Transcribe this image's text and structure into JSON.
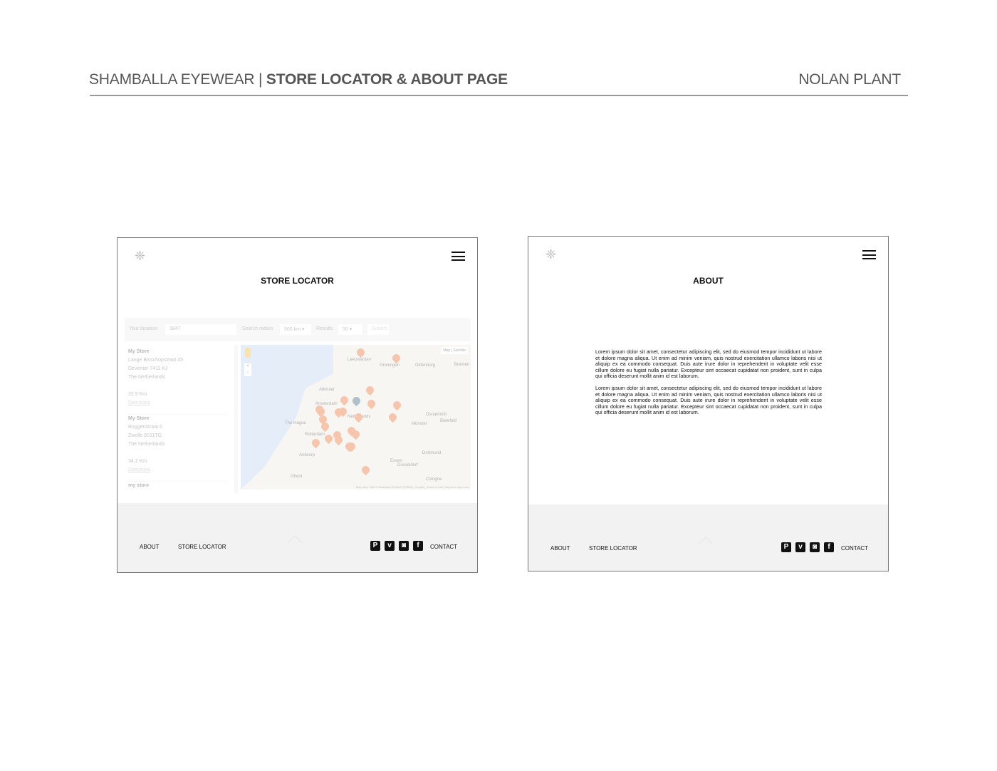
{
  "header": {
    "brand": "SHAMBALLA EYEWEAR",
    "separator": "|",
    "title": "STORE LOCATOR & ABOUT PAGE",
    "author": "NOLAN PLANT"
  },
  "store_page": {
    "title": "STORE LOCATOR",
    "search": {
      "location_label": "Your location",
      "location_value": "3847",
      "radius_label": "Search radius",
      "radius_value": "500 km",
      "results_label": "Results",
      "results_value": "50",
      "search_button": "Search"
    },
    "stores": [
      {
        "name": "My Store",
        "street": "Lange Bisschopstraat 45",
        "city": "Deventer 7411 KJ",
        "country": "The Netherlands",
        "distance": "33.9 Km",
        "directions": "Directions"
      },
      {
        "name": "My Store",
        "street": "Roggenstraat 6",
        "city": "Zwolle 8011TG",
        "country": "The Netherlands",
        "distance": "34.2 Km",
        "directions": "Directions"
      },
      {
        "name": "my store"
      }
    ],
    "map": {
      "type_map": "Map",
      "type_satellite": "Satellite",
      "labels": [
        "Leeuwarden",
        "Groningen",
        "Bremen",
        "Oldenburg",
        "Alkmaar",
        "Amsterdam",
        "Netherlands",
        "The Hague",
        "Rotterdam",
        "Münster",
        "Bielefeld",
        "Osnabrück",
        "Dortmund",
        "Essen",
        "Dusseldorf",
        "Antwerp",
        "Ghent",
        "Cologne"
      ],
      "attribution": "Map data ©2017 GeoBasis-DE/BKG (©2009), Google | Terms of Use | Report a map error",
      "pin_color": "#e76b2b",
      "center_pin_color": "#2e5f7a"
    }
  },
  "about_page": {
    "title": "ABOUT",
    "paragraphs": [
      "Lorem ipsum dolor sit amet, consectetur adipiscing elit, sed do eiusmod tempor incididunt ut labore et dolore magna aliqua. Ut enim ad minim veniam, quis nostrud exercitation ullamco laboris nisi ut aliquip ex ea commodo consequat. Duis aute irure dolor in reprehenderit in voluptate velit esse cillum dolore eu fugiat nulla pariatur. Excepteur sint occaecat cupidatat non proident, sunt in culpa qui officia deserunt mollit anim id est laborum.",
      "Lorem ipsum dolor sit amet, consectetur adipiscing elit, sed do eiusmod tempor incididunt ut labore et dolore magna aliqua. Ut enim ad minim veniam, quis nostrud exercitation ullamco laboris nisi ut aliquip ex ea commodo consequat. Duis aute irure dolor in reprehenderit in voluptate velit esse cillum dolore eu fugiat nulla pariatur. Excepteur sint occaecat cupidatat non proident, sunt in culpa qui officia deserunt mollit anim id est laborum."
    ]
  },
  "footer": {
    "about": "ABOUT",
    "store_locator": "STORE LOCATOR",
    "contact": "CONTACT",
    "social": [
      {
        "icon": "pinterest-icon",
        "glyph": "P"
      },
      {
        "icon": "vimeo-icon",
        "glyph": "v"
      },
      {
        "icon": "instagram-icon",
        "glyph": "◙"
      },
      {
        "icon": "facebook-icon",
        "glyph": "f"
      }
    ]
  }
}
